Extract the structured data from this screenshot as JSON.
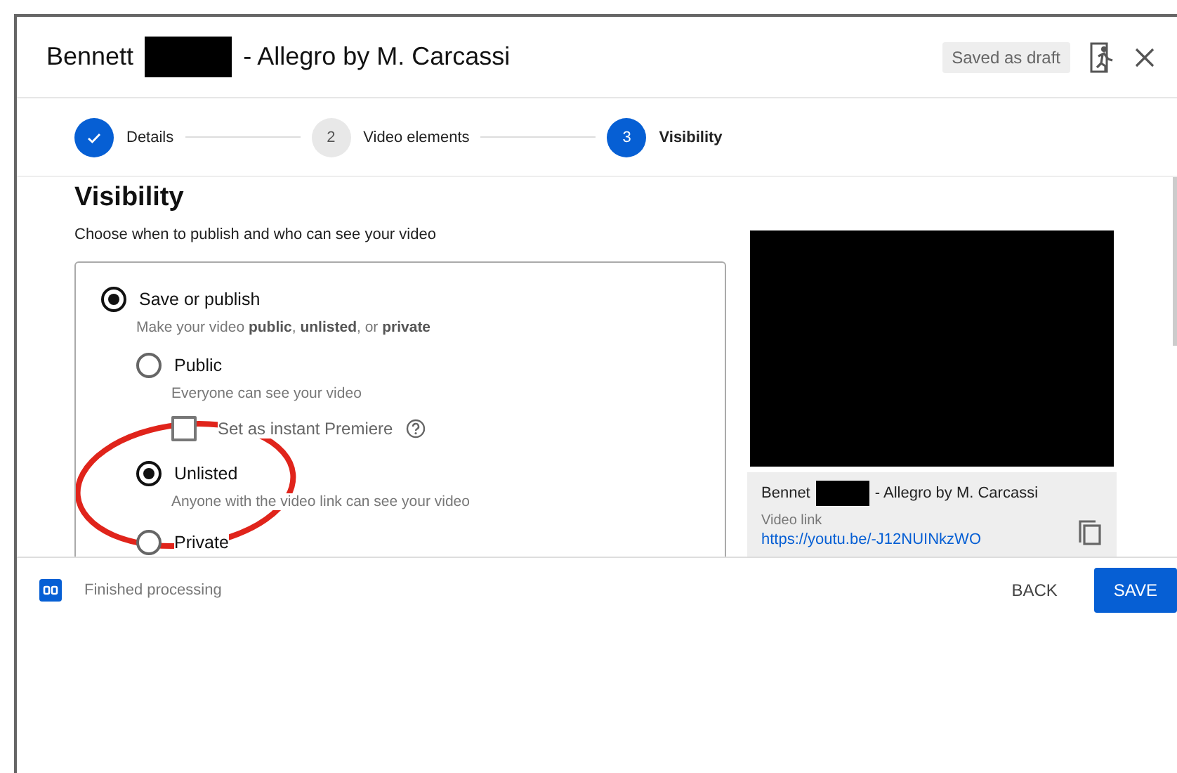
{
  "dialog": {
    "title_parts": [
      "Bennett",
      "- Allegro by M. Carcassi"
    ],
    "draft_badge": "Saved as draft"
  },
  "steps": [
    {
      "label": "Details",
      "kind": "done",
      "selected": false
    },
    {
      "label": "Video elements",
      "marker": "2",
      "kind": "todo",
      "selected": false
    },
    {
      "label": "Visibility",
      "marker": "3",
      "kind": "todo",
      "selected": true
    }
  ],
  "visibility": {
    "heading": "Visibility",
    "subtitle": "Choose when to publish and who can see your video",
    "options": [
      {
        "label": "Save or publish",
        "description": "Make your video **public**, **unlisted**, or **private**",
        "selected": true,
        "children": [
          {
            "label": "Public",
            "description": "Everyone can see your video",
            "selected": false,
            "checkbox": {
              "label": "Set as instant Premiere",
              "checked": false
            }
          },
          {
            "label": "Unlisted",
            "description": "Anyone with the video link can see your video",
            "selected": true
          },
          {
            "label": "Private",
            "selected": false
          }
        ]
      }
    ]
  },
  "preview": {
    "caption_parts": [
      "Bennet",
      "- Allegro by M. Carcassi"
    ],
    "link_label": "Video link",
    "link": "https://youtu.be/-J12NUINkzWO"
  },
  "footer": {
    "status": "Finished processing",
    "buttons": [
      {
        "label": "BACK",
        "kind": "text"
      },
      {
        "label": "SAVE",
        "kind": "primary"
      }
    ]
  }
}
